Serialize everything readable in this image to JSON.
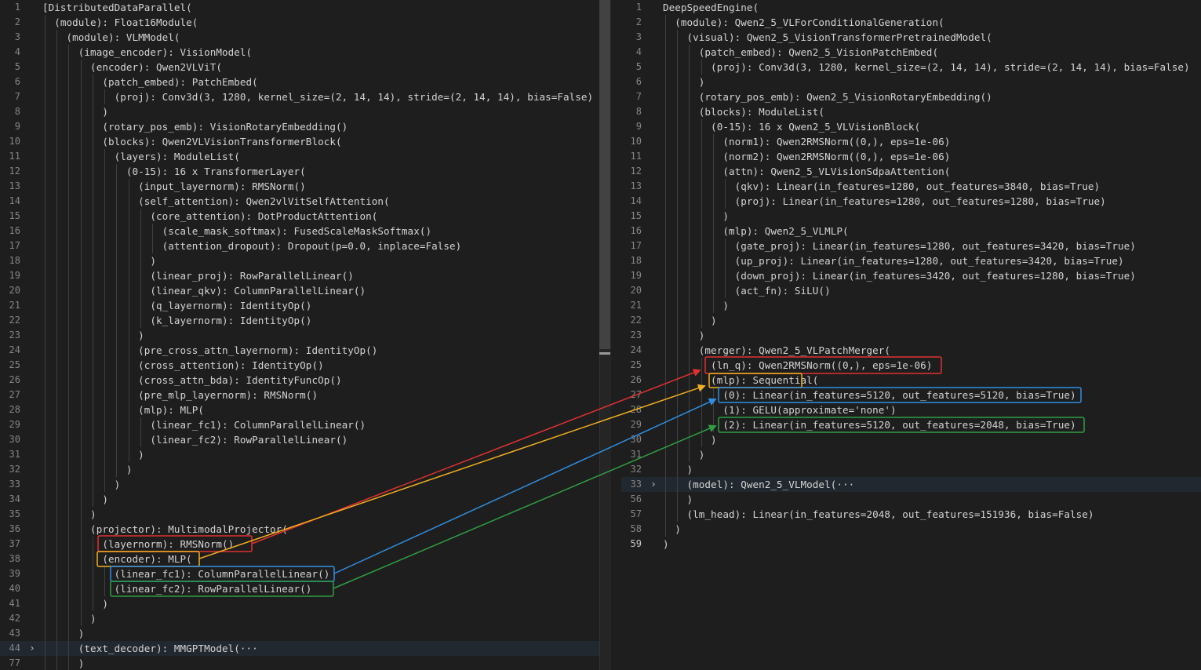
{
  "left": {
    "lines": [
      {
        "n": "1",
        "t": "[DistributedDataParallel("
      },
      {
        "n": "2",
        "t": "  (module): Float16Module("
      },
      {
        "n": "3",
        "t": "    (module): VLMModel("
      },
      {
        "n": "4",
        "t": "      (image_encoder): VisionModel("
      },
      {
        "n": "5",
        "t": "        (encoder): Qwen2VLViT("
      },
      {
        "n": "6",
        "t": "          (patch_embed): PatchEmbed("
      },
      {
        "n": "7",
        "t": "            (proj): Conv3d(3, 1280, kernel_size=(2, 14, 14), stride=(2, 14, 14), bias=False)"
      },
      {
        "n": "8",
        "t": "          )"
      },
      {
        "n": "9",
        "t": "          (rotary_pos_emb): VisionRotaryEmbedding()"
      },
      {
        "n": "10",
        "t": "          (blocks): Qwen2VLVisionTransformerBlock("
      },
      {
        "n": "11",
        "t": "            (layers): ModuleList("
      },
      {
        "n": "12",
        "t": "              (0-15): 16 x TransformerLayer("
      },
      {
        "n": "13",
        "t": "                (input_layernorm): RMSNorm()"
      },
      {
        "n": "14",
        "t": "                (self_attention): Qwen2vlVitSelfAttention("
      },
      {
        "n": "15",
        "t": "                  (core_attention): DotProductAttention("
      },
      {
        "n": "16",
        "t": "                    (scale_mask_softmax): FusedScaleMaskSoftmax()"
      },
      {
        "n": "17",
        "t": "                    (attention_dropout): Dropout(p=0.0, inplace=False)"
      },
      {
        "n": "18",
        "t": "                  )"
      },
      {
        "n": "19",
        "t": "                  (linear_proj): RowParallelLinear()"
      },
      {
        "n": "20",
        "t": "                  (linear_qkv): ColumnParallelLinear()"
      },
      {
        "n": "21",
        "t": "                  (q_layernorm): IdentityOp()"
      },
      {
        "n": "22",
        "t": "                  (k_layernorm): IdentityOp()"
      },
      {
        "n": "23",
        "t": "                )"
      },
      {
        "n": "24",
        "t": "                (pre_cross_attn_layernorm): IdentityOp()"
      },
      {
        "n": "25",
        "t": "                (cross_attention): IdentityOp()"
      },
      {
        "n": "26",
        "t": "                (cross_attn_bda): IdentityFuncOp()"
      },
      {
        "n": "27",
        "t": "                (pre_mlp_layernorm): RMSNorm()"
      },
      {
        "n": "28",
        "t": "                (mlp): MLP("
      },
      {
        "n": "29",
        "t": "                  (linear_fc1): ColumnParallelLinear()"
      },
      {
        "n": "30",
        "t": "                  (linear_fc2): RowParallelLinear()"
      },
      {
        "n": "31",
        "t": "                )"
      },
      {
        "n": "32",
        "t": "              )"
      },
      {
        "n": "33",
        "t": "            )"
      },
      {
        "n": "34",
        "t": "          )"
      },
      {
        "n": "35",
        "t": "        )"
      },
      {
        "n": "36",
        "t": "        (projector): MultimodalProjector("
      },
      {
        "n": "37",
        "t": "          (layernorm): RMSNorm()"
      },
      {
        "n": "38",
        "t": "          (encoder): MLP("
      },
      {
        "n": "39",
        "t": "            (linear_fc1): ColumnParallelLinear()"
      },
      {
        "n": "40",
        "t": "            (linear_fc2): RowParallelLinear()"
      },
      {
        "n": "41",
        "t": "          )"
      },
      {
        "n": "42",
        "t": "        )"
      },
      {
        "n": "43",
        "t": "      )"
      },
      {
        "n": "44",
        "t": "      (text_decoder): MMGPTModel(···",
        "fold": true
      },
      {
        "n": "77",
        "t": "      )"
      }
    ]
  },
  "right": {
    "lines": [
      {
        "n": "1",
        "t": "DeepSpeedEngine("
      },
      {
        "n": "2",
        "t": "  (module): Qwen2_5_VLForConditionalGeneration("
      },
      {
        "n": "3",
        "t": "    (visual): Qwen2_5_VisionTransformerPretrainedModel("
      },
      {
        "n": "4",
        "t": "      (patch_embed): Qwen2_5_VisionPatchEmbed("
      },
      {
        "n": "5",
        "t": "        (proj): Conv3d(3, 1280, kernel_size=(2, 14, 14), stride=(2, 14, 14), bias=False)"
      },
      {
        "n": "6",
        "t": "      )"
      },
      {
        "n": "7",
        "t": "      (rotary_pos_emb): Qwen2_5_VisionRotaryEmbedding()"
      },
      {
        "n": "8",
        "t": "      (blocks): ModuleList("
      },
      {
        "n": "9",
        "t": "        (0-15): 16 x Qwen2_5_VLVisionBlock("
      },
      {
        "n": "10",
        "t": "          (norm1): Qwen2RMSNorm((0,), eps=1e-06)"
      },
      {
        "n": "11",
        "t": "          (norm2): Qwen2RMSNorm((0,), eps=1e-06)"
      },
      {
        "n": "12",
        "t": "          (attn): Qwen2_5_VLVisionSdpaAttention("
      },
      {
        "n": "13",
        "t": "            (qkv): Linear(in_features=1280, out_features=3840, bias=True)"
      },
      {
        "n": "14",
        "t": "            (proj): Linear(in_features=1280, out_features=1280, bias=True)"
      },
      {
        "n": "15",
        "t": "          )"
      },
      {
        "n": "16",
        "t": "          (mlp): Qwen2_5_VLMLP("
      },
      {
        "n": "17",
        "t": "            (gate_proj): Linear(in_features=1280, out_features=3420, bias=True)"
      },
      {
        "n": "18",
        "t": "            (up_proj): Linear(in_features=1280, out_features=3420, bias=True)"
      },
      {
        "n": "19",
        "t": "            (down_proj): Linear(in_features=3420, out_features=1280, bias=True)"
      },
      {
        "n": "20",
        "t": "            (act_fn): SiLU()"
      },
      {
        "n": "21",
        "t": "          )"
      },
      {
        "n": "22",
        "t": "        )"
      },
      {
        "n": "23",
        "t": "      )"
      },
      {
        "n": "24",
        "t": "      (merger): Qwen2_5_VLPatchMerger("
      },
      {
        "n": "25",
        "t": "        (ln_q): Qwen2RMSNorm((0,), eps=1e-06)"
      },
      {
        "n": "26",
        "t": "        (mlp): Sequential("
      },
      {
        "n": "27",
        "t": "          (0): Linear(in_features=5120, out_features=5120, bias=True)"
      },
      {
        "n": "28",
        "t": "          (1): GELU(approximate='none')"
      },
      {
        "n": "29",
        "t": "          (2): Linear(in_features=5120, out_features=2048, bias=True)"
      },
      {
        "n": "30",
        "t": "        )"
      },
      {
        "n": "31",
        "t": "      )"
      },
      {
        "n": "32",
        "t": "    )"
      },
      {
        "n": "33",
        "t": "    (model): Qwen2_5_VLModel(···",
        "fold": true
      },
      {
        "n": "56",
        "t": "    )"
      },
      {
        "n": "57",
        "t": "    (lm_head): Linear(in_features=2048, out_features=151936, bias=False)"
      },
      {
        "n": "58",
        "t": "  )"
      },
      {
        "n": "59",
        "t": ")",
        "cur": true
      }
    ]
  },
  "fold_glyph": "›",
  "mappings": [
    {
      "name": "layernorm-to-ln_q",
      "color": "#e03131"
    },
    {
      "name": "encoder-to-mlp",
      "color": "#f2b01e"
    },
    {
      "name": "linear_fc1-to-linear0",
      "color": "#2f8fe0"
    },
    {
      "name": "linear_fc2-to-linear2",
      "color": "#2f9e44"
    }
  ]
}
